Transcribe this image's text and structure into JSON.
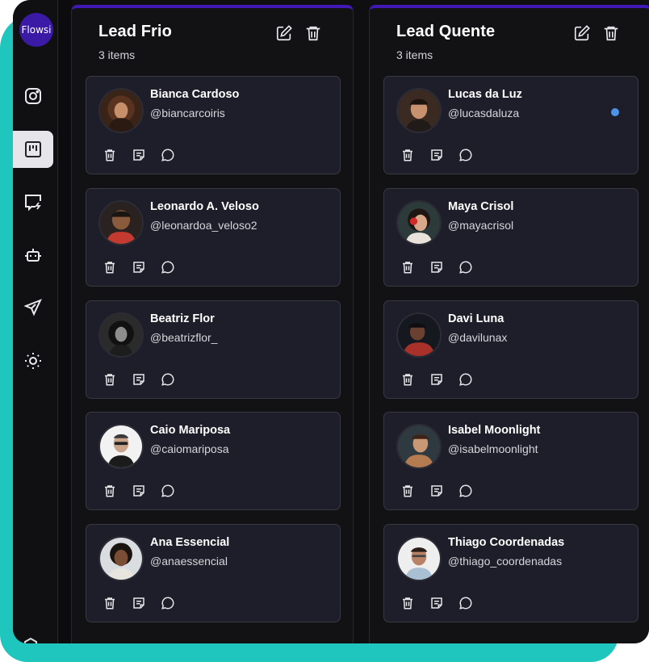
{
  "app": {
    "logo_text": "Flowsi",
    "brand_color": "#3b1aa6",
    "accent_color": "#4218b6",
    "frame_color": "#1ec6bd"
  },
  "sidebar": {
    "items": [
      {
        "icon": "instagram-icon",
        "active": false
      },
      {
        "icon": "kanban-board-icon",
        "active": true
      },
      {
        "icon": "flash-message-icon",
        "active": false
      },
      {
        "icon": "bot-icon",
        "active": false
      },
      {
        "icon": "send-icon",
        "active": false
      },
      {
        "icon": "sun-icon",
        "active": false
      }
    ]
  },
  "columns": [
    {
      "title": "Lead Frio",
      "count": "3 items",
      "cards": [
        {
          "name": "Bianca Cardoso",
          "handle": "@biancarcoiris",
          "unread": false
        },
        {
          "name": "Leonardo A. Veloso",
          "handle": "@leonardoa_veloso2",
          "unread": false
        },
        {
          "name": "Beatriz Flor",
          "handle": "@beatrizflor_",
          "unread": false
        },
        {
          "name": "Caio Mariposa",
          "handle": "@caiomariposa",
          "unread": false
        },
        {
          "name": "Ana Essencial",
          "handle": "@anaessencial",
          "unread": false
        }
      ]
    },
    {
      "title": "Lead Quente",
      "count": "3 items",
      "cards": [
        {
          "name": "Lucas da Luz",
          "handle": "@lucasdaluza",
          "unread": true
        },
        {
          "name": "Maya Crisol",
          "handle": "@mayacrisol",
          "unread": false
        },
        {
          "name": "Davi Luna",
          "handle": "@davilunax",
          "unread": false
        },
        {
          "name": "Isabel Moonlight",
          "handle": "@isabelmoonlight",
          "unread": false
        },
        {
          "name": "Thiago Coordenadas",
          "handle": "@thiago_coordenadas",
          "unread": false
        }
      ]
    }
  ],
  "card_actions": [
    "trash-icon",
    "note-icon",
    "chat-icon"
  ],
  "column_actions": [
    "edit-icon",
    "trash-icon"
  ]
}
